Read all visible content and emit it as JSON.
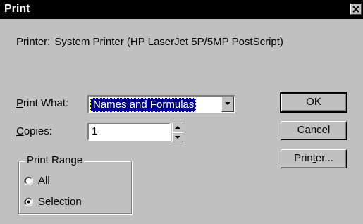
{
  "window": {
    "title": "Print",
    "close_glyph": "✕"
  },
  "printer": {
    "label": "Printer:",
    "value": "System Printer (HP LaserJet 5P/5MP PostScript)"
  },
  "print_what": {
    "label_accel": "P",
    "label_rest": "rint What:",
    "selected": "Names and Formulas"
  },
  "copies": {
    "label_accel": "C",
    "label_rest": "opies:",
    "value": "1"
  },
  "print_range": {
    "label": "Print Range",
    "options": [
      {
        "accel": "A",
        "rest": "ll",
        "selected": false
      },
      {
        "accel": "S",
        "rest": "election",
        "selected": true
      }
    ]
  },
  "buttons": {
    "ok": "OK",
    "cancel": "Cancel",
    "printer_pre": "Prin",
    "printer_accel": "t",
    "printer_post": "er..."
  },
  "colors": {
    "dialog_bg": "#c0c0c0",
    "titlebar_bg": "#000000",
    "selection_bg": "#000080"
  },
  "icons": {
    "close": "close-icon",
    "combo_arrow": "chevron-down-icon",
    "spin_up": "triangle-up-icon",
    "spin_down": "triangle-down-icon"
  }
}
